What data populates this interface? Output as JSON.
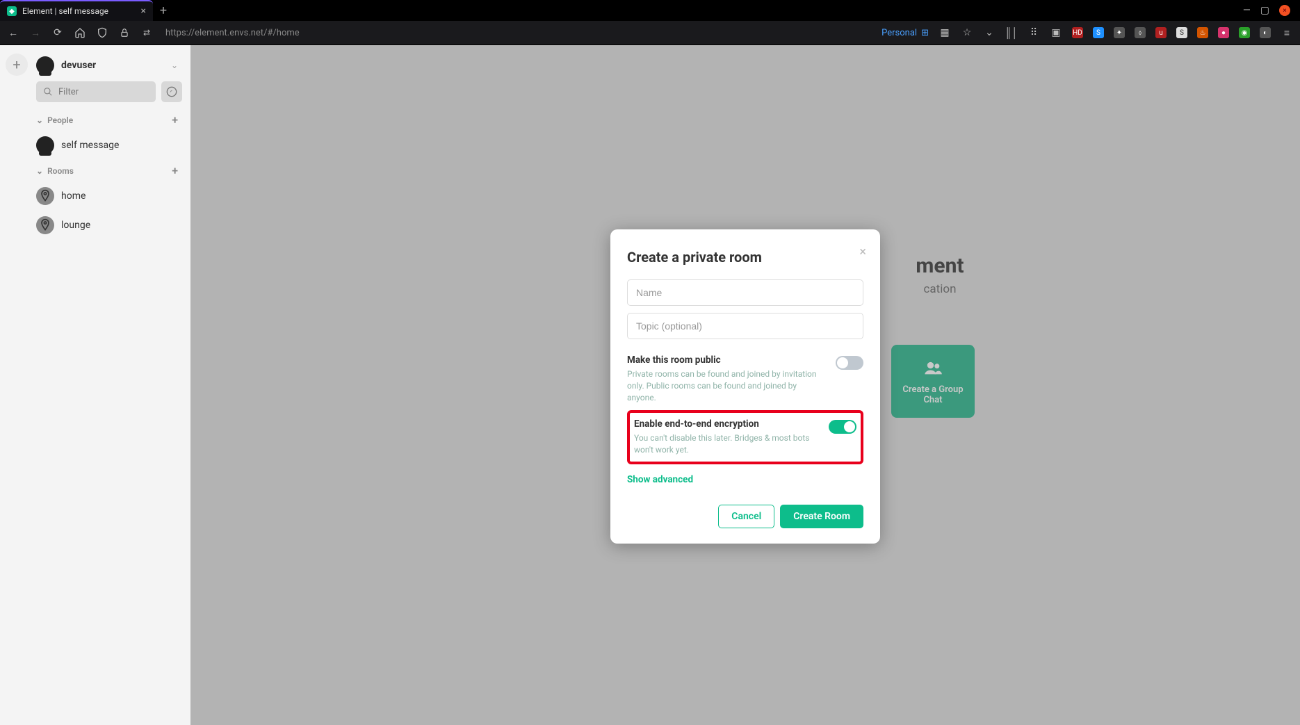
{
  "browser": {
    "tab_title": "Element | self message",
    "url": "https://element.envs.net/#/home",
    "profile_label": "Personal"
  },
  "sidebar": {
    "username": "devuser",
    "filter_placeholder": "Filter",
    "sections": {
      "people": {
        "label": "People",
        "items": [
          {
            "label": "self message"
          }
        ]
      },
      "rooms": {
        "label": "Rooms",
        "items": [
          {
            "label": "home"
          },
          {
            "label": "lounge"
          }
        ]
      }
    }
  },
  "welcome": {
    "title_suffix": "ment",
    "subtitle_suffix": "cation",
    "card_group_chat": "Create a Group Chat"
  },
  "modal": {
    "title": "Create a private room",
    "name_placeholder": "Name",
    "topic_placeholder": "Topic (optional)",
    "public": {
      "label": "Make this room public",
      "desc": "Private rooms can be found and joined by invitation only. Public rooms can be found and joined by anyone.",
      "on": false
    },
    "e2ee": {
      "label": "Enable end-to-end encryption",
      "desc": "You can't disable this later. Bridges & most bots won't work yet.",
      "on": true
    },
    "show_advanced": "Show advanced",
    "cancel": "Cancel",
    "create": "Create Room"
  }
}
